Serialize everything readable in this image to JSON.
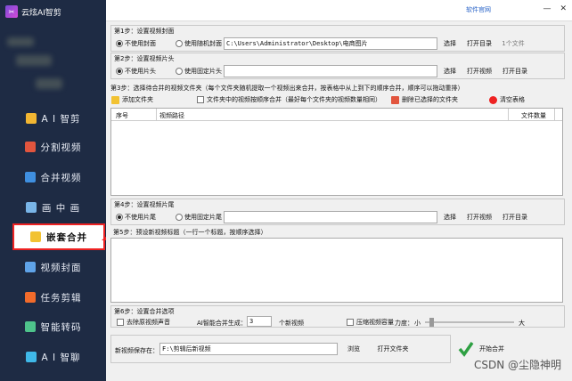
{
  "app": {
    "title": "云炫AI智剪",
    "logo_char": "✂"
  },
  "sidebar": {
    "items": [
      {
        "label": "A I 智剪",
        "icon": "ai-cut-icon",
        "color": "#f2b632"
      },
      {
        "label": "分割视频",
        "icon": "split-video-icon",
        "color": "#e2553e"
      },
      {
        "label": "合并视频",
        "icon": "merge-video-icon",
        "color": "#3f8fe0"
      },
      {
        "label": "画 中 画",
        "icon": "picture-in-picture-icon",
        "color": "#79b5e8"
      },
      {
        "label": "嵌套合并",
        "icon": "nested-merge-icon",
        "color": "#f2c232",
        "active": true
      },
      {
        "label": "视频封面",
        "icon": "video-cover-icon",
        "color": "#5fa3e8"
      },
      {
        "label": "任务剪辑",
        "icon": "task-edit-icon",
        "color": "#f26b2b"
      },
      {
        "label": "智能转码",
        "icon": "smart-transcode-icon",
        "color": "#4ec38b"
      },
      {
        "label": "A I 智聊",
        "icon": "ai-chat-icon",
        "color": "#3fb8e8"
      }
    ]
  },
  "topbar": {
    "website_link": "软件官网",
    "minimize": "—",
    "close": "✕"
  },
  "step1": {
    "title": "第1步：设置视频封面",
    "radio_none": "不使用封面",
    "radio_random": "使用随机封面",
    "path": "C:\\Users\\Administrator\\Desktop\\电商图片",
    "select": "选择",
    "open_dir": "打开目录",
    "count": "1个文件"
  },
  "step2": {
    "title": "第2步：设置视频片头",
    "radio_none": "不使用片头",
    "radio_fixed": "使用固定片头",
    "path": "",
    "select": "选择",
    "open_video": "打开视频",
    "open_dir": "打开目录"
  },
  "step3": {
    "title": "第3步：选择待合并的视频文件夹（每个文件夹随机提取一个视频出来合并，按表格中从上到下的顺序合并，顺序可以拖动重排）",
    "add_folder": "添加文件夹",
    "sequential_merge": "文件夹中的视频按顺序合并（最好每个文件夹的视频数量相同）",
    "delete_selected": "删除已选择的文件夹",
    "clear_table": "清空表格",
    "columns": [
      "序号",
      "视频路径",
      "文件数量"
    ]
  },
  "step4": {
    "title": "第4步：设置视频片尾",
    "radio_none": "不使用片尾",
    "radio_fixed": "使用固定片尾",
    "path": "",
    "select": "选择",
    "open_video": "打开视频",
    "open_dir": "打开目录"
  },
  "step5": {
    "title": "第5步：预设新视频标题（一行一个标题，按顺序选择）"
  },
  "step6": {
    "title": "第6步：设置合并选项",
    "remove_audio": "去除原视频声音",
    "ai_generate_label": "AI智能合并生成：",
    "ai_generate_value": "3",
    "ai_generate_unit": "个新视频",
    "compress": "压缩视频容量",
    "strength_label": "力度：",
    "strength_small": "小",
    "strength_large": "大",
    "strength_level": 0.05
  },
  "save": {
    "label": "新视频保存在：",
    "path": "F:\\剪辑后新视频",
    "browse": "浏览",
    "open_folder": "打开文件夹",
    "start": "开始合并"
  },
  "watermark": "CSDN @尘隐神明"
}
